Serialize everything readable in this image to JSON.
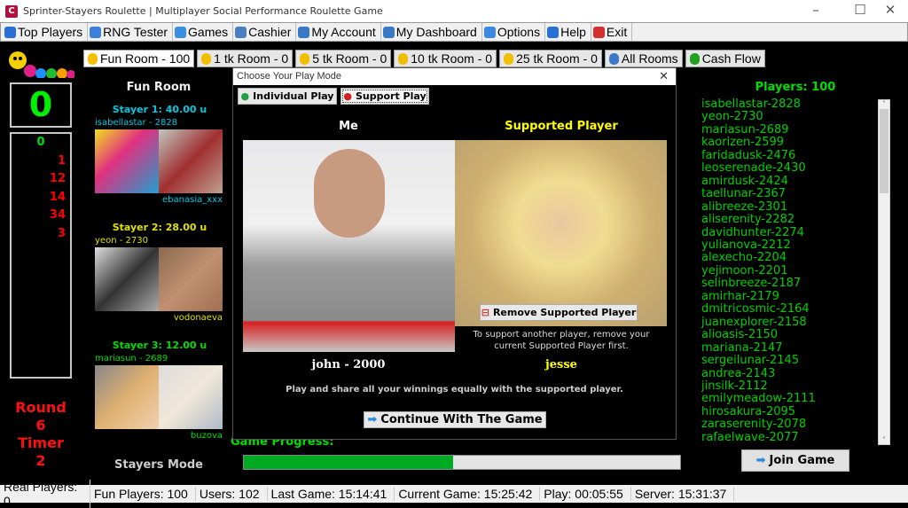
{
  "window": {
    "title": "Sprinter-Stayers Roulette | Multiplayer Social Performance Roulette Game",
    "minimize": "–",
    "maximize": "☐",
    "close": "✕",
    "app_icon": "C"
  },
  "menu": [
    {
      "label": "Top Players",
      "icon": "hourglass-icon",
      "color": "#2a6fd6"
    },
    {
      "label": "RNG Tester",
      "icon": "compass-icon",
      "color": "#3b7fd8"
    },
    {
      "label": "Games",
      "icon": "gear-icon",
      "color": "#3b8fe0"
    },
    {
      "label": "Cashier",
      "icon": "calculator-icon",
      "color": "#4a7fc0"
    },
    {
      "label": "My Account",
      "icon": "user-icon",
      "color": "#3a78c8"
    },
    {
      "label": "My Dashboard",
      "icon": "monitor-icon",
      "color": "#3a78c8"
    },
    {
      "label": "Options",
      "icon": "options-icon",
      "color": "#3a8ae0"
    },
    {
      "label": "Help",
      "icon": "help-icon",
      "color": "#2a6fd6"
    },
    {
      "label": "Exit",
      "icon": "exit-icon",
      "color": "#d03030"
    }
  ],
  "rooms": [
    {
      "label": "Fun Room - 100",
      "icon": "smiley-icon",
      "color": "#f5c000",
      "active": true
    },
    {
      "label": "1 tk Room - 0",
      "icon": "crown-icon",
      "color": "#f0c000"
    },
    {
      "label": "5 tk Room - 0",
      "icon": "star-icon",
      "color": "#f0c000"
    },
    {
      "label": "10 tk Room - 0",
      "icon": "sun-icon",
      "color": "#f0c000"
    },
    {
      "label": "25 tk Room - 0",
      "icon": "shield-icon",
      "color": "#f0c000"
    },
    {
      "label": "All Rooms",
      "icon": "tv-icon",
      "color": "#3a78c8"
    },
    {
      "label": "Cash Flow",
      "icon": "dollar-icon",
      "color": "#20a020"
    }
  ],
  "result": "0",
  "history": [
    {
      "v": "0",
      "c": "#00dd00"
    },
    {
      "v": "1",
      "c": "#ff0000"
    },
    {
      "v": "12",
      "c": "#ff0000"
    },
    {
      "v": "14",
      "c": "#ff0000"
    },
    {
      "v": "34",
      "c": "#ff0000"
    },
    {
      "v": "3",
      "c": "#ff0000"
    }
  ],
  "round": {
    "label": "Round",
    "value": "6"
  },
  "timer": {
    "label": "Timer",
    "value": "2"
  },
  "room_title": "Fun Room",
  "stayers": [
    {
      "head": "Stayer 1: 40.00 u",
      "player": "isabellastar - 2828",
      "supported": "ebanasia_xxx",
      "color": "#00c8e0"
    },
    {
      "head": "Stayer 2: 28.00 u",
      "player": "yeon - 2730",
      "supported": "vodonaeva",
      "color": "#e0e000"
    },
    {
      "head": "Stayer 3: 12.00 u",
      "player": "mariasun - 2689",
      "supported": "buzova",
      "color": "#00dd00"
    }
  ],
  "mode": "Stayers Mode",
  "progress": {
    "label": "Game Progress:",
    "value": 0.48,
    "color": "#00aa22"
  },
  "players": {
    "title": "Players: 100",
    "list": [
      "isabellastar-2828",
      "yeon-2730",
      "mariasun-2689",
      "kaorizen-2599",
      "faridadusk-2476",
      "leoserenade-2430",
      "amirdusk-2424",
      "taellunar-2367",
      "alibreeze-2301",
      "aliserenity-2282",
      "davidhunter-2274",
      "yulianova-2212",
      "alexecho-2204",
      "yejimoon-2201",
      "selinbreeze-2187",
      "amirhar-2179",
      "dmitricosmic-2164",
      "juanexplorer-2158",
      "alioasis-2150",
      "mariana-2147",
      "sergeilunar-2145",
      "andrea-2143",
      "jinsilk-2112",
      "emilymeadow-2111",
      "hirosakura-2095",
      "zaraserenity-2078",
      "rafaelwave-2077"
    ]
  },
  "join_button": "Join Game",
  "dialog": {
    "title": "Choose Your Play Mode",
    "close": "✕",
    "individual": "Individual Play",
    "support": "Support Play",
    "me": "Me",
    "supported_label": "Supported Player",
    "me_name": "john - 2000",
    "supported_name": "jesse",
    "remove": "Remove Supported Player",
    "hint1": "To support another player, remove your",
    "hint2": "current Supported Player first.",
    "desc": "Play and share all your winnings equally with the supported player.",
    "continue": "Continue With The Game"
  },
  "status": [
    "Real Players: 0",
    "Fun Players: 100",
    "Users: 102",
    "Last Game: 15:14:41",
    "Current Game: 15:25:42",
    "Play: 00:05:55",
    "Server: 15:31:37"
  ]
}
